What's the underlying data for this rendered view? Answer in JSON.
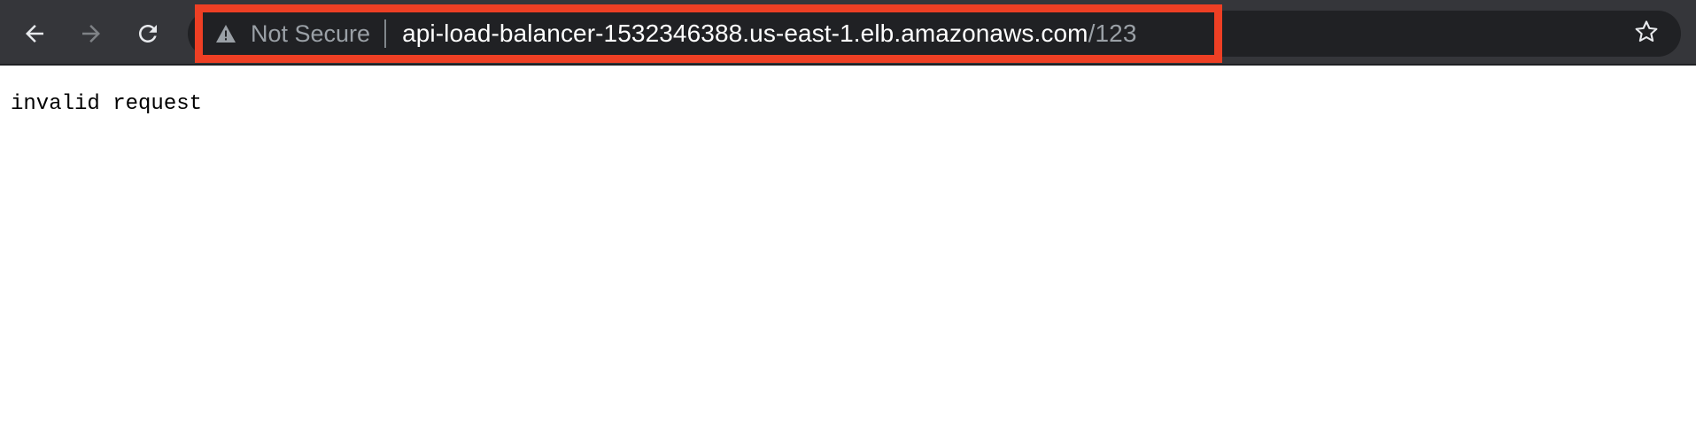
{
  "toolbar": {
    "back_icon": "arrow-left-icon",
    "forward_icon": "arrow-right-icon",
    "reload_icon": "reload-icon",
    "bookmark_icon": "star-icon"
  },
  "omnibox": {
    "security_icon": "warning-triangle-icon",
    "security_label": "Not Secure",
    "url_host": "api-load-balancer-1532346388.us-east-1.elb.amazonaws.com",
    "url_path": "/123"
  },
  "page": {
    "body_text": "invalid request"
  },
  "colors": {
    "toolbar_bg": "#35363a",
    "omnibox_bg": "#202124",
    "highlight_border": "#ee3f24",
    "url_host": "#ffffff",
    "url_path": "#9aa0a6",
    "page_bg": "#ffffff"
  }
}
